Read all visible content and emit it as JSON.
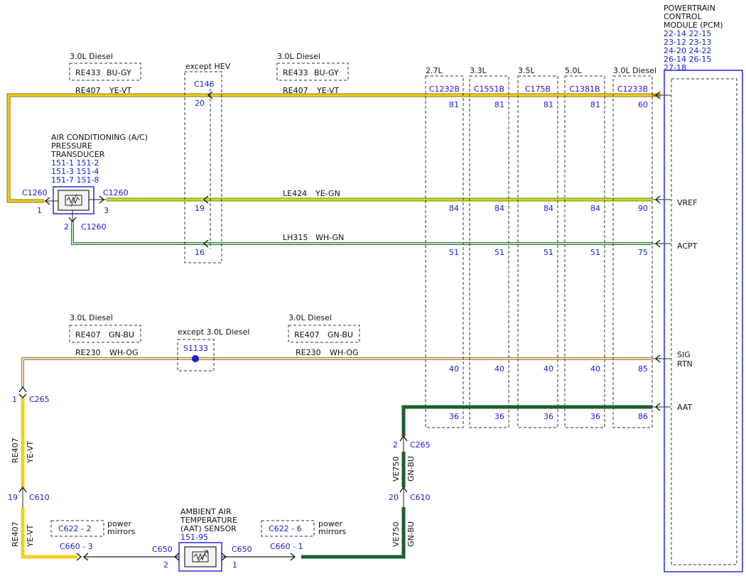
{
  "pcm": {
    "title": [
      "POWERTRAIN",
      "CONTROL",
      "MODULE (PCM)"
    ],
    "refs": [
      "22-14 22-15",
      "23-12 23-13",
      "24-20 24-22",
      "26-14 26-15",
      "27-18"
    ],
    "pins": {
      "vref": "VREF",
      "acpt": "ACPT",
      "sig": "SIG",
      "rtn": "RTN",
      "aat": "AAT"
    }
  },
  "engines": [
    {
      "label": "2.7L",
      "connector": "C1232B",
      "pins": [
        "81",
        "84",
        "51",
        "40",
        "36"
      ]
    },
    {
      "label": "3.3L",
      "connector": "C1551B",
      "pins": [
        "81",
        "84",
        "51",
        "40",
        "36"
      ]
    },
    {
      "label": "3.5L",
      "connector": "C175B",
      "pins": [
        "81",
        "84",
        "51",
        "40",
        "36"
      ]
    },
    {
      "label": "5.0L",
      "connector": "C1381B",
      "pins": [
        "81",
        "84",
        "51",
        "40",
        "36"
      ]
    },
    {
      "label": "3.0L Diesel",
      "connector": "C1233B",
      "pins": [
        "60",
        "90",
        "75",
        "85",
        "86"
      ]
    }
  ],
  "hev": {
    "label": "except HEV",
    "connector": "C146",
    "pins": [
      "20",
      "19",
      "16"
    ]
  },
  "diesel_boxes": {
    "top_left": {
      "label": "3.0L Diesel",
      "circuit": "RE433",
      "color": "BU-GY"
    },
    "top_mid": {
      "label": "3.0L Diesel",
      "circuit": "RE433",
      "color": "BU-GY"
    },
    "sig_left": {
      "label": "3.0L Diesel",
      "circuit": "RE407",
      "color": "GN-BU"
    },
    "sig_mid": {
      "label": "3.0L Diesel",
      "circuit": "RE407",
      "color": "GN-BU"
    }
  },
  "wires": {
    "re407_left": {
      "circuit": "RE407",
      "color": "YE-VT"
    },
    "re407_mid": {
      "circuit": "RE407",
      "color": "YE-VT"
    },
    "le424": {
      "circuit": "LE424",
      "color": "YE-GN"
    },
    "lh315": {
      "circuit": "LH315",
      "color": "WH-GN"
    },
    "re230_left": {
      "circuit": "RE230",
      "color": "WH-OG"
    },
    "re230_mid": {
      "circuit": "RE230",
      "color": "WH-OG"
    },
    "re407_v1": {
      "circuit": "RE407",
      "color": "YE-VT"
    },
    "re407_v2": {
      "circuit": "RE407",
      "color": "YE-VT"
    },
    "ve750_v1": {
      "circuit": "VE750",
      "color": "GN-BU"
    },
    "ve750_v2": {
      "circuit": "VE750",
      "color": "GN-BU"
    }
  },
  "ac_sensor": {
    "name": [
      "AIR CONDITIONING (A/C)",
      "PRESSURE",
      "TRANSDUCER"
    ],
    "refs": [
      "151-1 151-2",
      "151-3 151-4",
      "151-7 151-8"
    ],
    "conn_left": "C1260",
    "pin_left": "1",
    "conn_right": "C1260",
    "pin_right": "3",
    "conn_bottom": "C1260",
    "pin_bottom": "2"
  },
  "splice": {
    "label": "except 3.0L Diesel",
    "id": "S1133"
  },
  "c265_left": {
    "connector": "C265",
    "pin": "1"
  },
  "c610_left": {
    "connector": "C610",
    "pin": "19"
  },
  "c265_right": {
    "connector": "C265",
    "pin": "2"
  },
  "c610_right": {
    "connector": "C610",
    "pin": "20"
  },
  "mirrors": [
    {
      "conn": "C622 - 2",
      "note": [
        "power",
        "mirrors"
      ],
      "c660": "C660 - 3"
    },
    {
      "conn": "C622 - 6",
      "note": [
        "power",
        "mirrors"
      ],
      "c660": "C660 - 1"
    }
  ],
  "aat_sensor": {
    "name": [
      "AMBIENT AIR",
      "TEMPERATURE",
      "(AAT) SENSOR"
    ],
    "ref": "151-95",
    "conn_left": "C650",
    "pin_left": "2",
    "conn_right": "C650",
    "pin_right": "1"
  },
  "wire_colors": {
    "yellow": "#f2cf1f",
    "yellow_green": "#c9dc2c",
    "green": "#2e9a3c",
    "white_green": "#86c486",
    "white_orange": "#e9c896",
    "dark_green": "#1d5f2c",
    "blue": "#1a1ad6"
  }
}
